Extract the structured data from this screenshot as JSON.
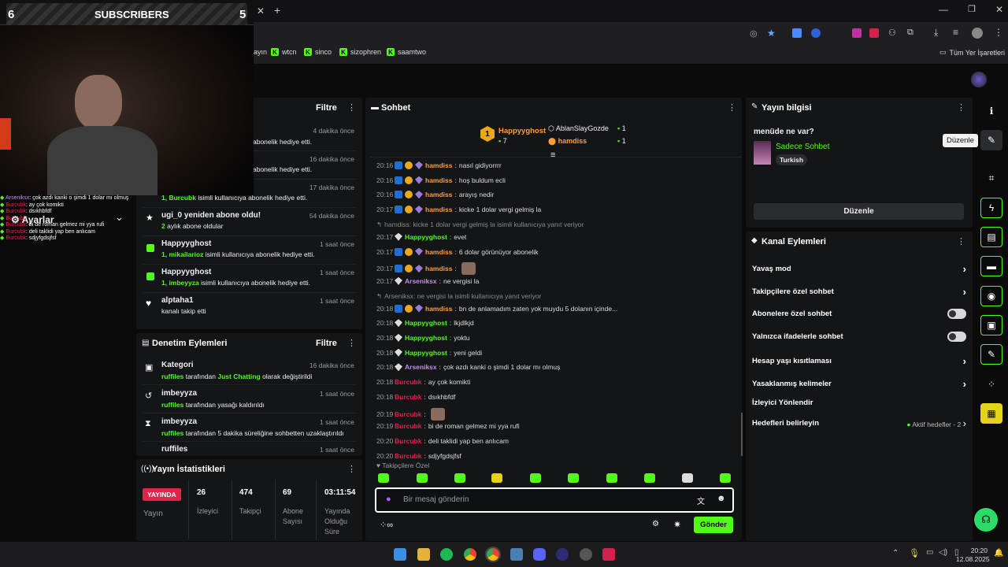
{
  "browser": {
    "new_tab": "+",
    "bookmarks": [
      "ayın",
      "wtcn",
      "sinco",
      "sizophren",
      "saamtwo"
    ],
    "other_bookmarks": "Tüm Yer İşaretleri"
  },
  "overlay": {
    "left_count": "6",
    "label": "SUBSCRIBERS",
    "right_count": "5",
    "mini_chat": [
      {
        "user": "Arseniksx",
        "text": "çok azdı kanki o şimdi 1 dolar mı olmuş",
        "color": "#c48df0"
      },
      {
        "user": "Burcubk",
        "text": "ay çok komikti",
        "color": "#e0244a"
      },
      {
        "user": "Burcubk",
        "text": "dsıkhbfdf",
        "color": "#e0244a"
      },
      {
        "user": "Burcubk",
        "text": "",
        "color": "#e0244a"
      },
      {
        "user": "Burcubk",
        "text": "bi de roman gelmez mi yya rufi",
        "color": "#e0244a"
      },
      {
        "user": "Burcubk",
        "text": "deli taklidi yap ben anlıcam",
        "color": "#e0244a"
      },
      {
        "user": "Burcubk",
        "text": "sdjyfgdsjfsf",
        "color": "#e0244a"
      }
    ],
    "settings_label": "Ayarlar"
  },
  "activity": {
    "filter_label": "Filtre",
    "items": [
      {
        "title": "",
        "text": "abonelik hediye etti.",
        "time": "4 dakika önce"
      },
      {
        "title": "",
        "text": "abonelik hediye etti.",
        "time": "16 dakika önce"
      },
      {
        "title": "",
        "highlight": "1, Burcubk",
        "text": "isimli kullanıcıya abonelik hediye etti.",
        "time": "17 dakika önce"
      },
      {
        "title": "ugi_0 yeniden abone oldu!",
        "highlight": "2",
        "text": "aylık abone oldular",
        "time": "54 dakika önce"
      },
      {
        "title": "Happyyghost",
        "highlight": "1, mikailarioz",
        "text": "isimli kullanıcıya abonelik hediye etti.",
        "time": "1 saat önce"
      },
      {
        "title": "Happyyghost",
        "highlight": "1, imbeyyza",
        "text": "isimli kullanıcıya abonelik hediye etti.",
        "time": "1 saat önce"
      },
      {
        "title": "alptaha1",
        "highlight": "",
        "text": "kanalı takip etti",
        "time": "1 saat önce"
      }
    ]
  },
  "moderation": {
    "title": "Denetim Eylemleri",
    "filter_label": "Filtre",
    "items": [
      {
        "title": "Kategori",
        "user": "ruffiles",
        "pre": "tarafından",
        "hl": "Just Chatting",
        "post": "olarak değiştirildi",
        "time": "16 dakika önce"
      },
      {
        "title": "imbeyyza",
        "user": "ruffiles",
        "pre": "tarafından yasağı kaldırıldı",
        "hl": "",
        "post": "",
        "time": "1 saat önce"
      },
      {
        "title": "imbeyyza",
        "user": "ruffiles",
        "pre": "tarafından 5 dakika süreliğine sohbetten uzaklaştırıldı",
        "hl": "",
        "post": "",
        "time": "1 saat önce"
      },
      {
        "title": "ruffiles",
        "user": "",
        "pre": "",
        "hl": "",
        "post": "",
        "time": "1 saat önce"
      }
    ]
  },
  "stats": {
    "title": "Yayın İstatistikleri",
    "live_badge": "YAYINDA",
    "live_label": "Yayın",
    "viewers": "26",
    "viewers_label": "İzleyici",
    "followers": "474",
    "followers_label": "Takipçi",
    "subs": "69",
    "subs_label": "Abone Sayısı",
    "uptime": "03:11:54",
    "uptime_label": "Yayında Olduğu Süre"
  },
  "chat": {
    "title": "Sohbet",
    "top_gifter": {
      "rank": "1",
      "name": "Happyyghost",
      "count": "7"
    },
    "gifter2": {
      "name": "AblanSlayGozde",
      "count": "1"
    },
    "gifter3": {
      "name": "hamdiss",
      "count": "1"
    },
    "messages": [
      {
        "time": "20:16",
        "user": "hamdiss",
        "cls": "n-or",
        "badges": "bgp",
        "text": "nasıl gidiyorrrr"
      },
      {
        "time": "20:16",
        "user": "hamdiss",
        "cls": "n-or",
        "badges": "bgp",
        "text": "hoş buldum ecli"
      },
      {
        "time": "20:16",
        "user": "hamdiss",
        "cls": "n-or",
        "badges": "bgp",
        "text": "arayış nedir"
      },
      {
        "time": "20:17",
        "user": "hamdiss",
        "cls": "n-or",
        "badges": "bgp",
        "text": "kicke 1 dolar vergi gelmiş la"
      },
      {
        "reply": "hamdiss: kicke 1 dolar vergi gelmiş la isimli kullanıcıya yanıt veriyor"
      },
      {
        "time": "20:17",
        "user": "Happyyghost",
        "cls": "n-gr",
        "badges": "g",
        "text": "evet"
      },
      {
        "time": "20:17",
        "user": "hamdiss",
        "cls": "n-or",
        "badges": "bgp",
        "text": "6 dolar görünüyor abonelik"
      },
      {
        "time": "20:17",
        "user": "hamdiss",
        "cls": "n-or",
        "badges": "bgp",
        "text": ""
      },
      {
        "time": "20:17",
        "user": "Arseniksx",
        "cls": "n-pk",
        "badges": "g",
        "text": "ne vergisi la"
      },
      {
        "reply": "Arseniksx: ne vergisi la isimli kullanıcıya yanıt veriyor"
      },
      {
        "time": "20:18",
        "user": "hamdiss",
        "cls": "n-or",
        "badges": "bgp",
        "text": "bn de anlamadım zaten yok muydu 5 dolanın içinde..."
      },
      {
        "time": "20:18",
        "user": "Happyyghost",
        "cls": "n-gr",
        "badges": "g",
        "text": "lkjdlkjd"
      },
      {
        "time": "20:18",
        "user": "Happyyghost",
        "cls": "n-gr",
        "badges": "g",
        "text": "yoktu"
      },
      {
        "time": "20:18",
        "user": "Happyyghost",
        "cls": "n-gr",
        "badges": "g",
        "text": "yeni geldi"
      },
      {
        "time": "20:18",
        "user": "Arseniksx",
        "cls": "n-pk",
        "badges": "g",
        "text": "çok azdı kanki o şimdi 1 dolar mı olmuş"
      },
      {
        "time": "20:18",
        "user": "Burcubk",
        "cls": "n-rd",
        "badges": "",
        "text": "ay çok komikti"
      },
      {
        "time": "20:18",
        "user": "Burcubk",
        "cls": "n-rd",
        "badges": "",
        "text": "dsıkhbfdf"
      },
      {
        "time": "20:19",
        "user": "Burcubk",
        "cls": "n-rd",
        "badges": "",
        "text": ""
      },
      {
        "time": "20:19",
        "user": "Burcubk",
        "cls": "n-rd",
        "badges": "",
        "text": "bi de roman gelmez mi yya rufi"
      },
      {
        "time": "20:20",
        "user": "Burcubk",
        "cls": "n-rd",
        "badges": "",
        "text": "deli taklidi yap ben anlıcam"
      },
      {
        "time": "20:20",
        "user": "Burcubk",
        "cls": "n-rd",
        "badges": "",
        "text": "sdjyfgdsjfsf"
      }
    ],
    "followers_only": "Takipçilere Özel",
    "input_placeholder": "Bir mesaj gönderin",
    "send_label": "Gönder"
  },
  "stream_info": {
    "title": "Yayın bilgisi",
    "heading": "menüde ne var?",
    "category": "Sadece Sohbet",
    "tag": "Turkish",
    "edit_label": "Düzenle",
    "tooltip": "Düzenle"
  },
  "channel_actions": {
    "title": "Kanal Eylemleri",
    "slow_mode": "Yavaş mod",
    "followers_chat": "Takipçilere özel sohbet",
    "subs_chat": "Abonelere özel sohbet",
    "emotes_chat": "Yalnızca ifadelerle sohbet",
    "age_limit": "Hesap yaşı kısıtlaması",
    "banned_words": "Yasaklanmış kelimeler",
    "redirect": "İzleyici Yönlendir",
    "goals": "Hedefleri belirleyin",
    "goals_status": "Aktif hedefler - 2"
  },
  "taskbar": {
    "time": "20:20",
    "date": "12.08.2025"
  }
}
